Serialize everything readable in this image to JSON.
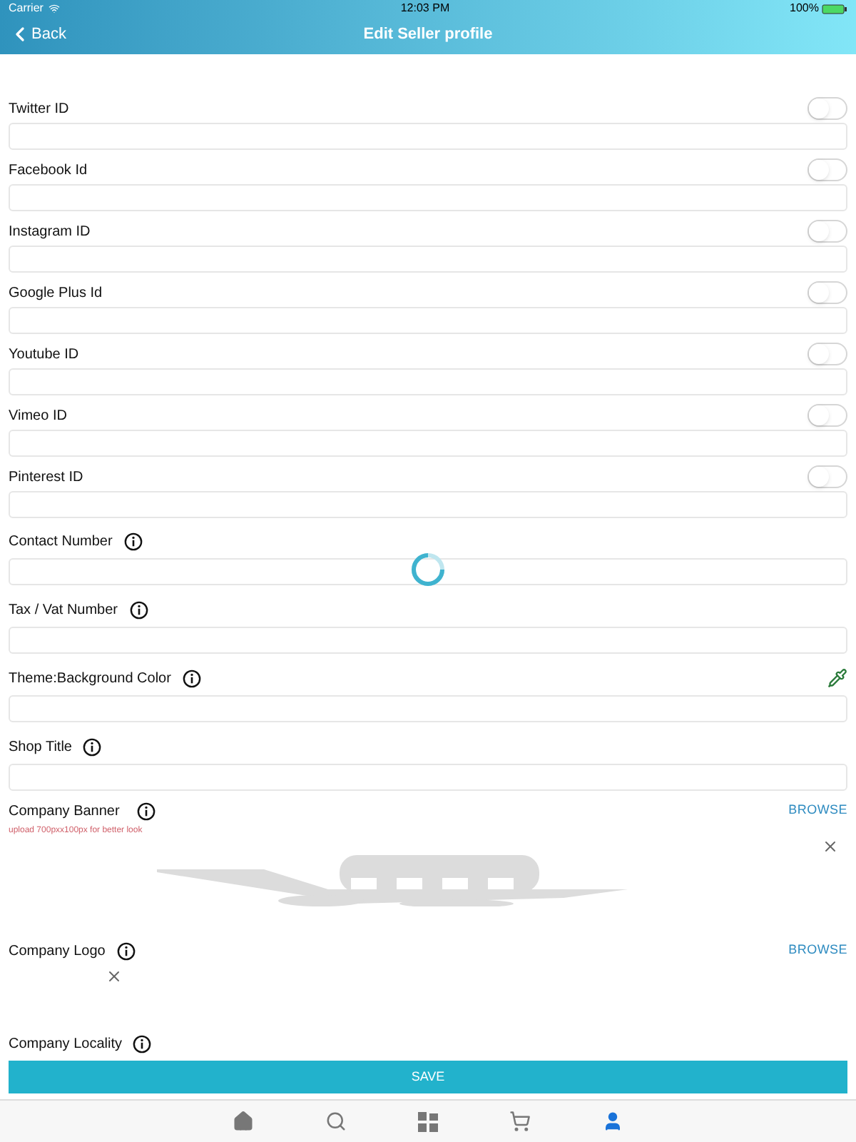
{
  "status_bar": {
    "carrier": "Carrier",
    "time": "12:03 PM",
    "battery": "100%"
  },
  "nav": {
    "back": "Back",
    "title": "Edit Seller profile"
  },
  "fields": [
    {
      "kind": "toggle",
      "label": "Twitter ID",
      "on": false
    },
    {
      "kind": "toggle",
      "label": "Facebook Id",
      "on": false
    },
    {
      "kind": "toggle",
      "label": "Instagram ID",
      "on": false
    },
    {
      "kind": "toggle",
      "label": "Google Plus Id",
      "on": false
    },
    {
      "kind": "toggle",
      "label": "Youtube ID",
      "on": false
    },
    {
      "kind": "toggle",
      "label": "Vimeo ID",
      "on": false
    },
    {
      "kind": "toggle",
      "label": "Pinterest ID",
      "on": false
    },
    {
      "kind": "info",
      "label": "Contact Number"
    },
    {
      "kind": "info",
      "label": "Tax / Vat Number"
    },
    {
      "kind": "color",
      "label": "Theme:Background Color"
    },
    {
      "kind": "info",
      "label": "Shop Title"
    },
    {
      "kind": "banner",
      "label": "Company Banner",
      "action": "BROWSE",
      "hint": "upload 700pxx100px for better look"
    },
    {
      "kind": "logo",
      "label": "Company Logo",
      "action": "BROWSE"
    },
    {
      "kind": "cut",
      "label": "Company Locality"
    }
  ],
  "save": "SAVE",
  "tabs": [
    {
      "kind": "home",
      "selected": false
    },
    {
      "kind": "search",
      "selected": false
    },
    {
      "kind": "grid",
      "selected": false
    },
    {
      "kind": "cart",
      "selected": false
    },
    {
      "kind": "user",
      "selected": true
    }
  ]
}
